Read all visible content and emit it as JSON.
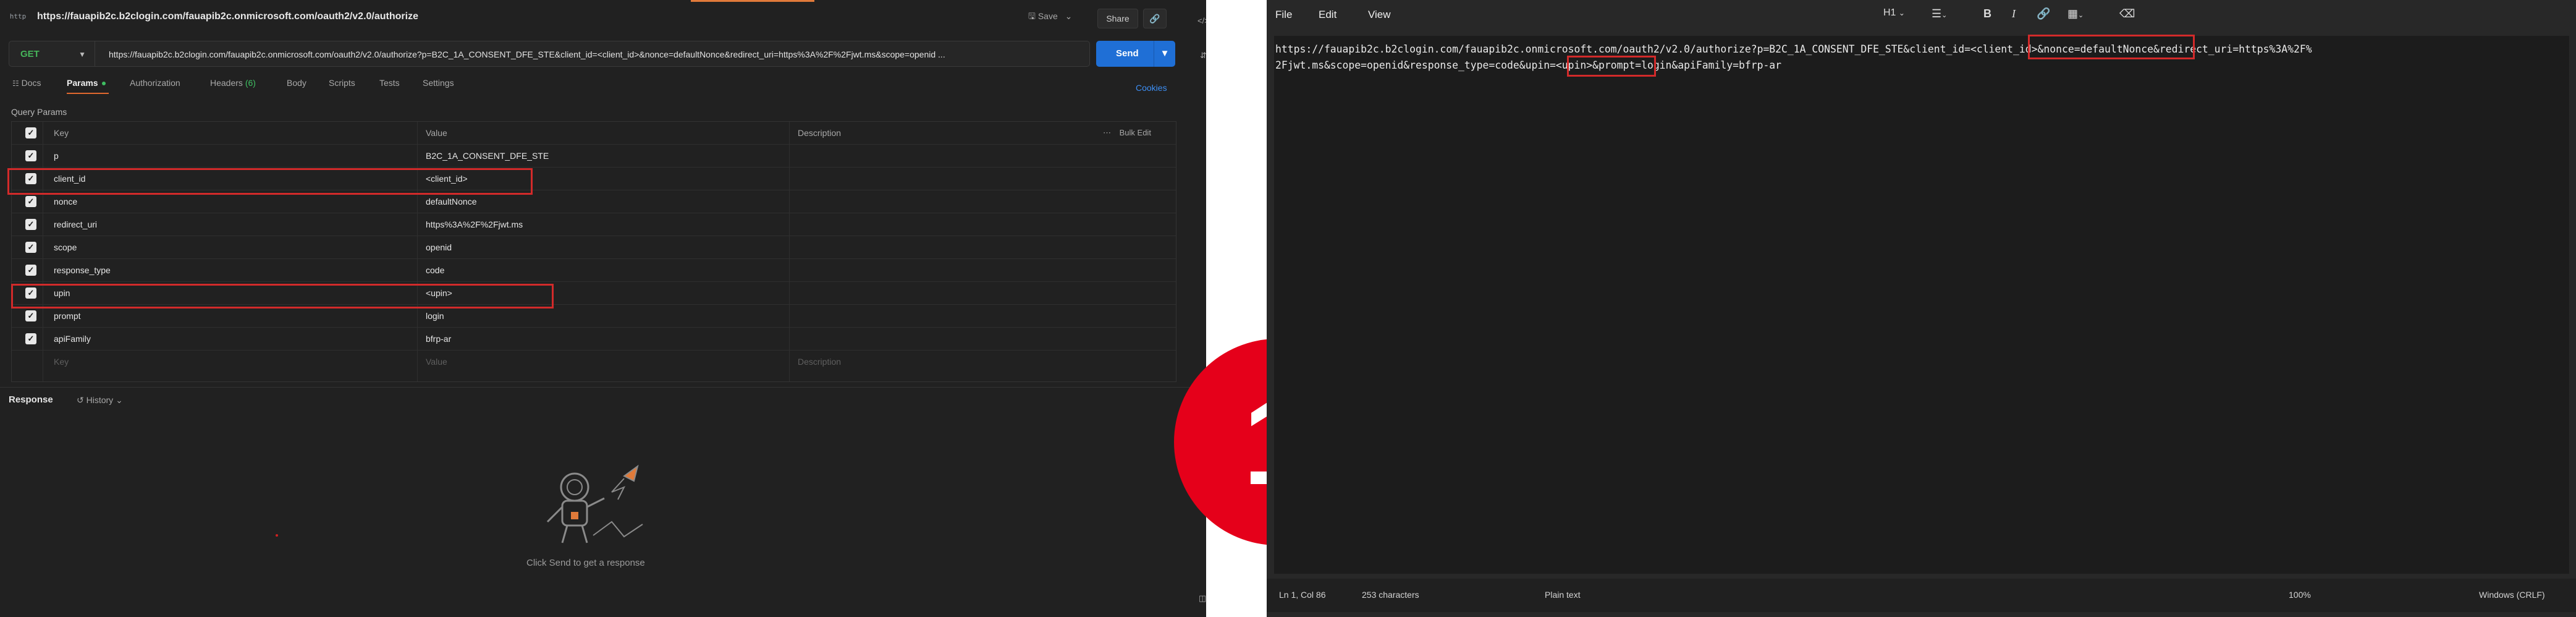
{
  "client": {
    "request_title": "https://fauapib2c.b2clogin.com/fauapib2c.onmicrosoft.com/oauth2/v2.0/authorize",
    "http_icon_text": "http",
    "save_label": "Save",
    "share_label": "Share",
    "method": "GET",
    "url": "https://fauapib2c.b2clogin.com/fauapib2c.onmicrosoft.com/oauth2/v2.0/authorize?p=B2C_1A_CONSENT_DFE_STE&client_id=<client_id>&nonce=defaultNonce&redirect_uri=https%3A%2F%2Fjwt.ms&scope=openid ...",
    "send_label": "Send",
    "tabs": {
      "docs": "Docs",
      "params": "Params",
      "authorization": "Authorization",
      "headers": "Headers",
      "headers_count": "(6)",
      "body": "Body",
      "scripts": "Scripts",
      "tests": "Tests",
      "settings": "Settings"
    },
    "cookies_label": "Cookies",
    "query_params_label": "Query Params",
    "columns": {
      "key": "Key",
      "value": "Value",
      "description": "Description",
      "bulk_edit": "Bulk Edit"
    },
    "params": [
      {
        "key": "p",
        "value": "B2C_1A_CONSENT_DFE_STE"
      },
      {
        "key": "client_id",
        "value": "<client_id>"
      },
      {
        "key": "nonce",
        "value": "defaultNonce"
      },
      {
        "key": "redirect_uri",
        "value": "https%3A%2F%2Fjwt.ms"
      },
      {
        "key": "scope",
        "value": "openid"
      },
      {
        "key": "response_type",
        "value": "code"
      },
      {
        "key": "upin",
        "value": "<upin>"
      },
      {
        "key": "prompt",
        "value": "login"
      },
      {
        "key": "apiFamily",
        "value": "bfrp-ar"
      }
    ],
    "placeholder": {
      "key": "Key",
      "value": "Value",
      "description": "Description"
    },
    "response_label": "Response",
    "history_label": "History",
    "empty_message": "Click Send to get a response"
  },
  "badge_number": "1",
  "notepad": {
    "menu": {
      "file": "File",
      "edit": "Edit",
      "view": "View"
    },
    "heading_dropdown": "H1",
    "line1": "https://fauapib2c.b2clogin.com/fauapib2c.onmicrosoft.com/oauth2/v2.0/authorize?p=B2C_1A_CONSENT_DFE_STE&client_id=<client_id>&nonce=defaultNonce&redirect_uri=https%3A%2F%",
    "line2": "2Fjwt.ms&scope=openid&response_type=code&upin=<upin>&prompt=login&apiFamily=bfrp-ar",
    "status": {
      "position": "Ln 1, Col 86",
      "characters": "253 characters",
      "format": "Plain text",
      "zoom": "100%",
      "line_ending": "Windows (CRLF)"
    }
  },
  "colors": {
    "highlight": "#d22a2a",
    "send": "#1f6fd6",
    "badge": "#e5001a",
    "get_method": "#46b55a",
    "tab_active_underline": "#e0682e"
  }
}
